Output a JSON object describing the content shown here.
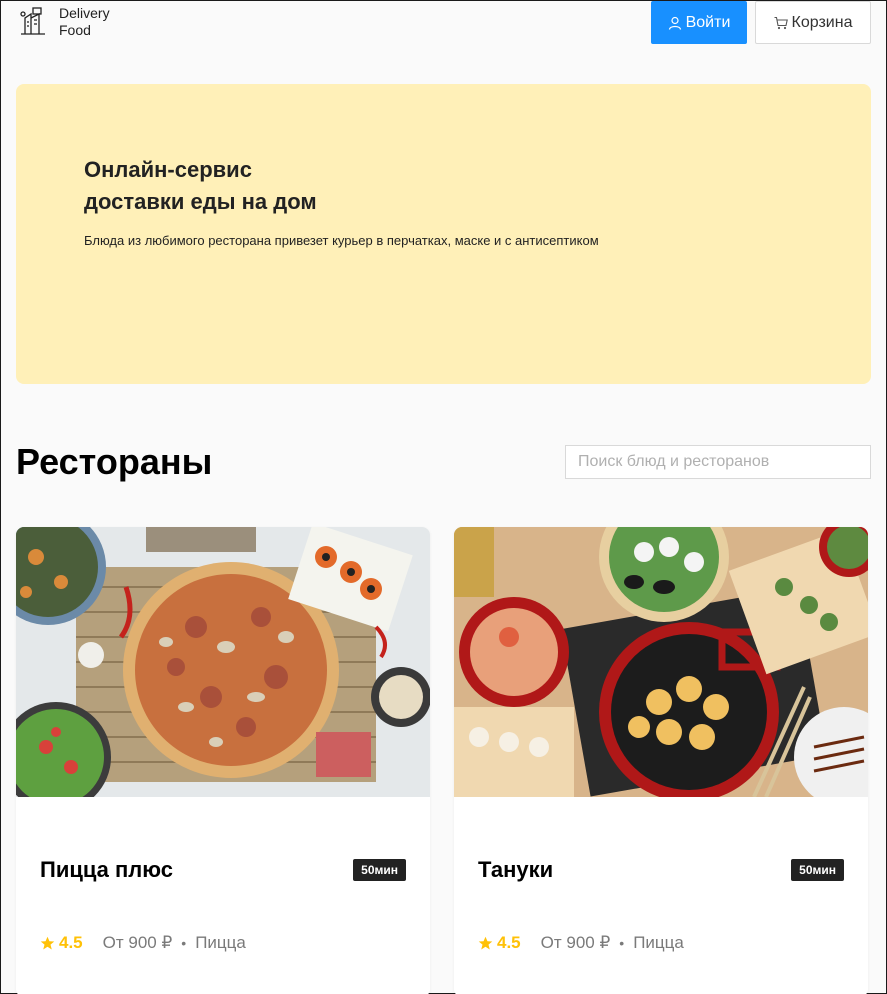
{
  "header": {
    "logo_line1": "Delivery",
    "logo_line2": "Food",
    "login_label": "Войти",
    "cart_label": "Корзина",
    "login_icon": "user-icon",
    "cart_icon": "cart-icon"
  },
  "promo": {
    "title_line1": "Онлайн-сервис",
    "title_line2": "доставки еды на дом",
    "text": "Блюда из любимого ресторана привезет курьер в перчатках, маске и с антисептиком"
  },
  "restaurants": {
    "title": "Рестораны",
    "search_placeholder": "Поиск блюд и ресторанов",
    "items": [
      {
        "name": "Пицца плюс",
        "time": "50мин",
        "rating": "4.5",
        "price": "От 900 ₽",
        "category": "Пицца",
        "image": "pizza-photo"
      },
      {
        "name": "Тануки",
        "time": "50мин",
        "rating": "4.5",
        "price": "От 900 ₽",
        "category": "Пицца",
        "image": "sushi-photo"
      }
    ]
  },
  "colors": {
    "primary": "#1890ff",
    "promo_bg": "#fff0b8",
    "rating": "#ffc107",
    "tag_bg": "#222222"
  }
}
